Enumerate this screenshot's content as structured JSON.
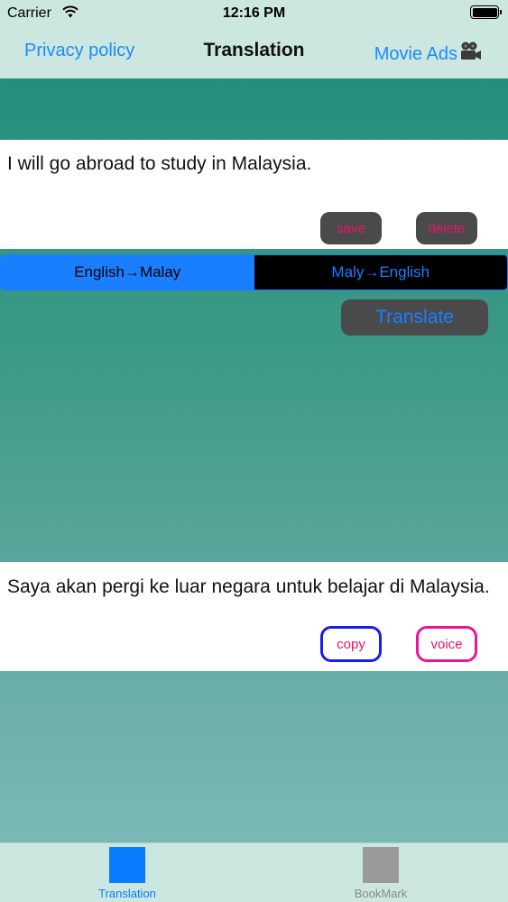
{
  "status_bar": {
    "carrier": "Carrier",
    "time": "12:16 PM",
    "battery_level": 1.0
  },
  "nav": {
    "left_link": "Privacy policy",
    "title": "Translation",
    "right_link": "Movie Ads",
    "right_icon": "movie-camera-icon"
  },
  "input": {
    "text": "I will go abroad to study in Malaysia.",
    "save_label": "save",
    "delete_label": "delete"
  },
  "direction": {
    "options": [
      "English→Malay",
      "Maly→English"
    ],
    "selected": "English→Malay"
  },
  "translate_label": "Translate",
  "output": {
    "text": "Saya akan pergi ke luar negara untuk belajar di Malaysia.",
    "copy_label": "copy",
    "voice_label": "voice"
  },
  "tabs": [
    {
      "label": "Translation",
      "active": true
    },
    {
      "label": "BookMark",
      "active": false
    }
  ],
  "colors": {
    "accent": "#0a7cff",
    "pink": "#e8156c",
    "teal": "#1e8c78"
  }
}
